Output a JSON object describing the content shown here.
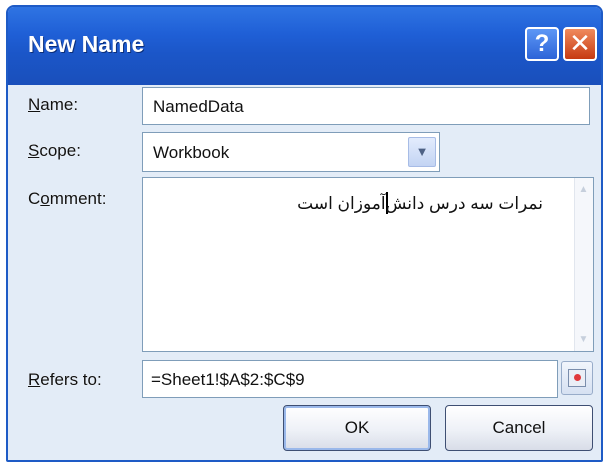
{
  "window": {
    "title": "New Name"
  },
  "titlebar": {
    "help_label": "?",
    "close_label": "✕"
  },
  "form": {
    "name": {
      "access_key": "N",
      "label_rest": "ame:",
      "value": "NamedData"
    },
    "scope": {
      "access_key": "S",
      "label_rest": "cope:",
      "value": "Workbook"
    },
    "comment": {
      "label_pre": "C",
      "access_key": "o",
      "label_post": "mment:",
      "value": "نمرات سه درس دانش‌آموزان است"
    },
    "refers_to": {
      "access_key": "R",
      "label_rest": "efers to:",
      "value": "=Sheet1!$A$2:$C$9"
    }
  },
  "buttons": {
    "ok": "OK",
    "cancel": "Cancel"
  },
  "icons": {
    "help": "help-icon",
    "close": "close-icon",
    "dropdown": "chevron-down-icon",
    "collapse": "collapse-dialog-icon",
    "scroll_up": "scroll-up-icon",
    "scroll_down": "scroll-down-icon"
  },
  "colors": {
    "titlebar": "#1f5fd6",
    "dialog_bg": "#e3ecf7",
    "close_button": "#c63a12"
  }
}
